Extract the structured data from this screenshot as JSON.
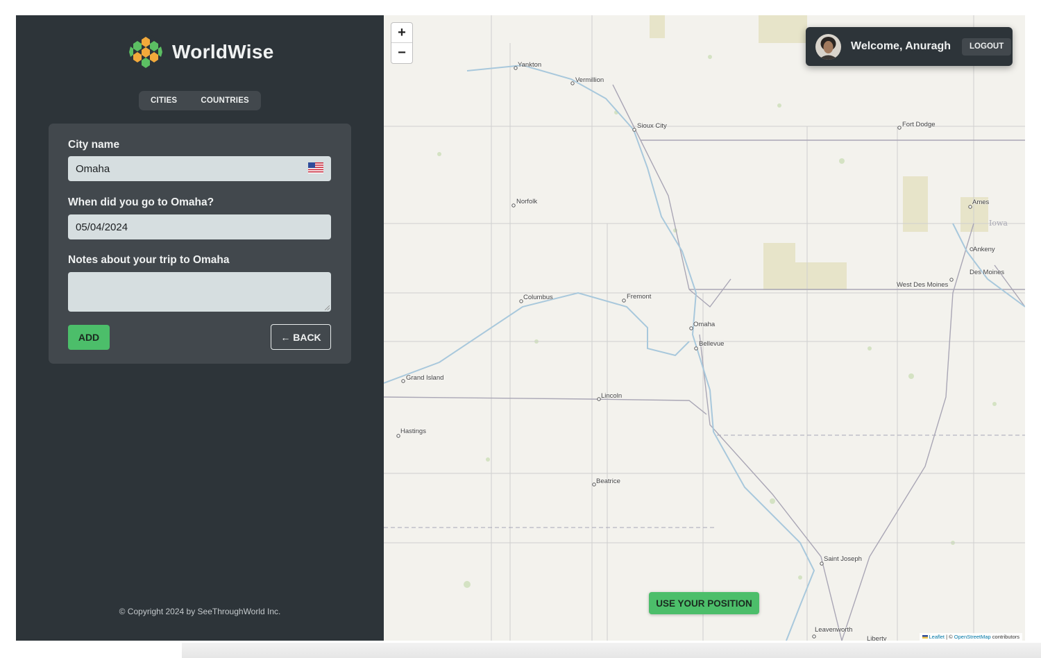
{
  "brand": {
    "name": "WorldWise",
    "logo_icon": "globe-hexagon-logo"
  },
  "tabs": [
    {
      "label": "CITIES"
    },
    {
      "label": "COUNTRIES"
    }
  ],
  "form": {
    "city_label": "City name",
    "city_value": "Omaha",
    "flag_icon": "us-flag-icon",
    "date_label": "When did you go to Omaha?",
    "date_value": "05/04/2024",
    "notes_label": "Notes about your trip to Omaha",
    "notes_value": "",
    "add_label": "ADD",
    "back_label": "← BACK"
  },
  "footer": {
    "copyright": "© Copyright 2024 by SeeThroughWorld Inc."
  },
  "map": {
    "zoom_in": "+",
    "zoom_out": "−",
    "use_position_label": "USE YOUR POSITION",
    "attribution": {
      "leaflet": "Leaflet",
      "separator": " | © ",
      "osm": "OpenStreetMap",
      "suffix": " contributors"
    },
    "places": {
      "yankton": "Yankton",
      "vermillion": "Vermillion",
      "sioux_city": "Sioux City",
      "fort_dodge": "Fort Dodge",
      "norfolk": "Norfolk",
      "ames": "Ames",
      "iowa": "Iowa",
      "ankeny": "Ankeny",
      "des_moines": "Des Moines",
      "west_des_moines": "West Des Moines",
      "columbus": "Columbus",
      "fremont": "Fremont",
      "omaha": "Omaha",
      "bellevue": "Bellevue",
      "grand_island": "Grand Island",
      "lincoln": "Lincoln",
      "hastings": "Hastings",
      "beatrice": "Beatrice",
      "saint_joseph": "Saint Joseph",
      "leavenworth": "Leavenworth",
      "liberty": "Liberty"
    }
  },
  "user": {
    "welcome": "Welcome, Anuragh",
    "logout_label": "LOGOUT"
  },
  "colors": {
    "sidebar": "#2d3439",
    "panel": "#42484d",
    "accent": "#4cbe6a",
    "input": "#d6dee0",
    "map_bg": "#f3f2ed"
  }
}
